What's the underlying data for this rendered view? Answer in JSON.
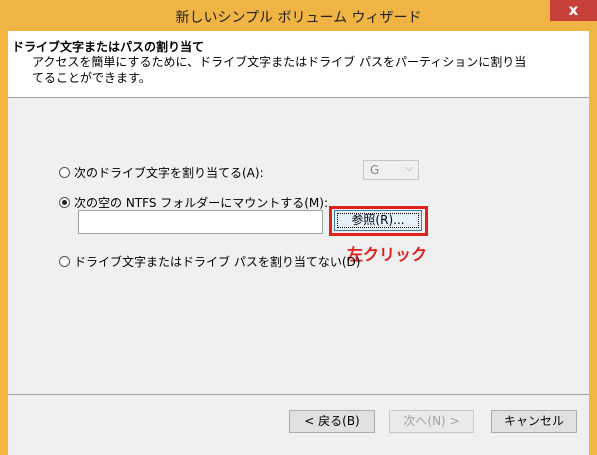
{
  "window": {
    "title": "新しいシンプル ボリューム ウィザード",
    "close_label": "x"
  },
  "header": {
    "title": "ドライブ文字またはパスの割り当て",
    "description": "アクセスを簡単にするために、ドライブ文字またはドライブ パスをパーティションに割り当てることができます。"
  },
  "options": {
    "assign_letter_label": "次のドライブ文字を割り当てる(A):",
    "assign_letter_checked": false,
    "drive_letter_value": "G",
    "mount_folder_label": "次の空の NTFS フォルダーにマウントする(M):",
    "mount_folder_checked": true,
    "mount_path_value": "",
    "browse_label": "参照(R)...",
    "no_assign_label": "ドライブ文字またはドライブ パスを割り当てない(D)",
    "no_assign_checked": false
  },
  "annotation": {
    "text": "左クリック",
    "color": "#e0201c"
  },
  "footer": {
    "back_label": "< 戻る(B)",
    "next_label": "次へ(N) >",
    "next_disabled": true,
    "cancel_label": "キャンセル"
  },
  "colors": {
    "titlebar": "#f0b445",
    "close": "#c7403a",
    "highlight": "#e0201c"
  }
}
